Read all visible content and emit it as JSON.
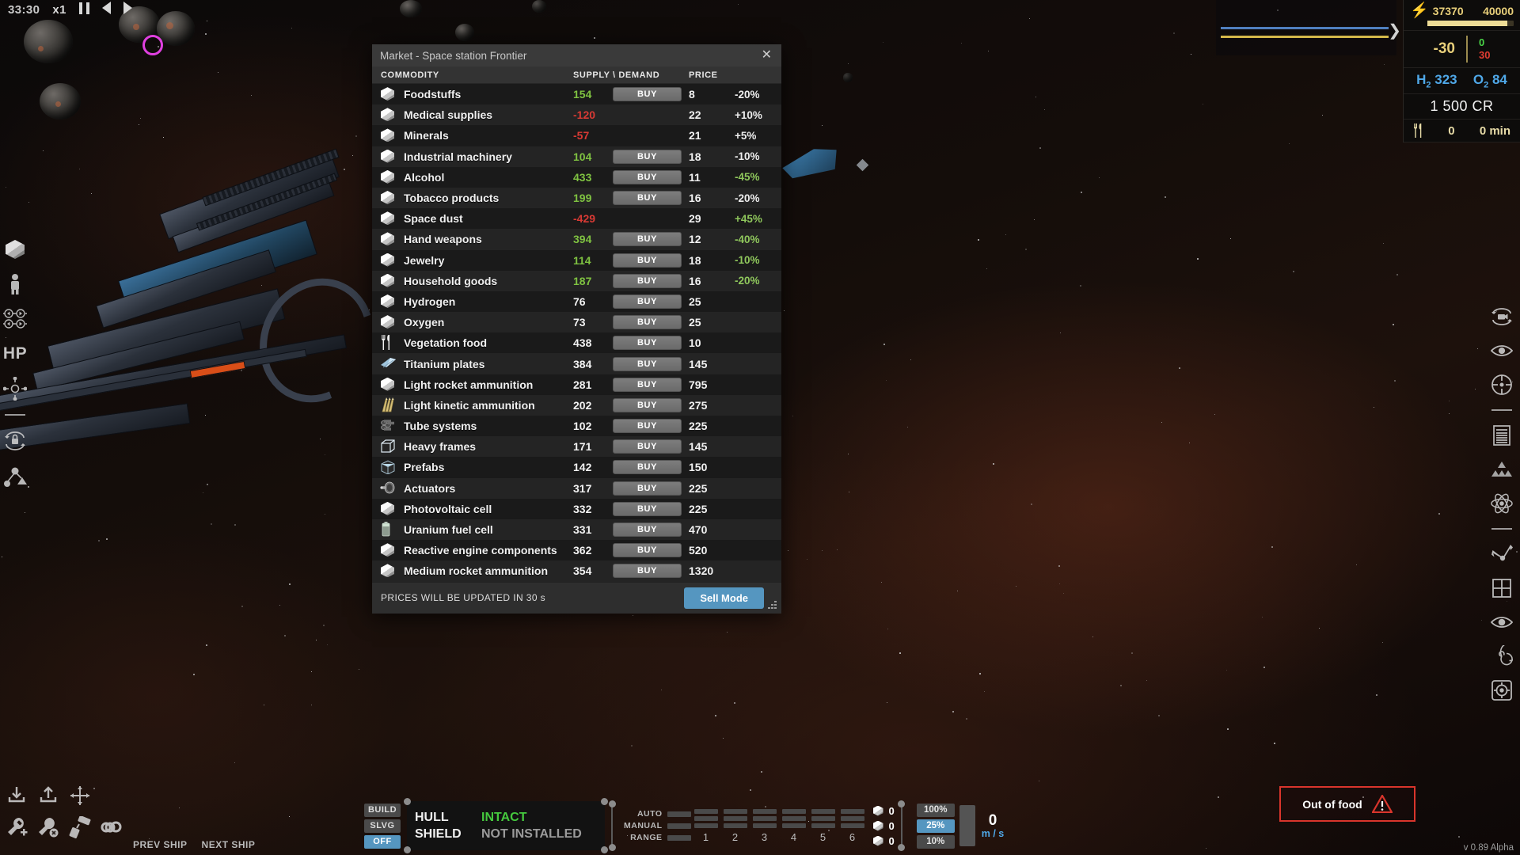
{
  "time_controls": {
    "clock": "33:30",
    "speed": "x1",
    "pause_icon": "pause-icon",
    "prev_icon": "step-back-icon",
    "next_icon": "step-forward-icon"
  },
  "left_toolbar": [
    {
      "name": "cargo-cube-icon",
      "label": ""
    },
    {
      "name": "crew-person-icon",
      "label": ""
    },
    {
      "name": "directional-arrows-icon",
      "label": ""
    },
    {
      "name": "hp-label",
      "label": "HP"
    },
    {
      "name": "crosshair-icon",
      "label": ""
    },
    {
      "name": "lock-rotate-icon",
      "label": ""
    },
    {
      "name": "node-graph-icon",
      "label": ""
    }
  ],
  "build_icons": [
    {
      "name": "download-icon"
    },
    {
      "name": "upload-icon"
    },
    {
      "name": "move-icon"
    },
    {
      "name": "wrench-add-icon"
    },
    {
      "name": "wrench-remove-icon"
    },
    {
      "name": "paint-roller-icon"
    },
    {
      "name": "infinity-icon"
    }
  ],
  "right_toolbar": [
    {
      "name": "camera-rotate-icon"
    },
    {
      "name": "eye-icon"
    },
    {
      "name": "target-reticle-icon"
    },
    {
      "name": "document-list-icon"
    },
    {
      "name": "pyramid-stack-icon"
    },
    {
      "name": "atom-icon"
    },
    {
      "name": "trajectory-icon"
    },
    {
      "name": "grid-icon"
    },
    {
      "name": "eye-visibility-icon"
    },
    {
      "name": "galaxy-spiral-icon"
    },
    {
      "name": "target-lock-icon"
    }
  ],
  "hud": {
    "energy_icon": "lightning-bolt-icon",
    "energy_current": "37370",
    "energy_max": "40000",
    "energy_percent": 93,
    "power_balance": "-30",
    "power_in": "0",
    "power_out": "30",
    "hydrogen_label": "H",
    "hydrogen_sub": "2",
    "hydrogen_value": "323",
    "oxygen_label": "O",
    "oxygen_sub": "2",
    "oxygen_value": "84",
    "credits": "1 500 CR",
    "food_icon": "cutlery-icon",
    "food_amount": "0",
    "food_time": "0 min",
    "expand_icon": "chevron-right-icon"
  },
  "market": {
    "title": "Market - Space station Frontier",
    "close_icon": "close-icon",
    "columns": {
      "commodity": "COMMODITY",
      "supply": "SUPPLY \\ DEMAND",
      "price": "PRICE"
    },
    "buy_label": "BUY",
    "footer_timer": "PRICES WILL BE UPDATED IN 30 s",
    "sell_mode_label": "Sell Mode",
    "accent_color": "#5596c0",
    "resize_grip_icon": "resize-grip-icon",
    "rows": [
      {
        "icon": "cube-icon",
        "name": "Foodstuffs",
        "supply": "154",
        "supply_state": "pos",
        "buy": true,
        "price": "8",
        "pct": "-20%",
        "pct_hl": false
      },
      {
        "icon": "cube-icon",
        "name": "Medical supplies",
        "supply": "-120",
        "supply_state": "neg",
        "buy": false,
        "price": "22",
        "pct": "+10%",
        "pct_hl": false
      },
      {
        "icon": "cube-icon",
        "name": "Minerals",
        "supply": "-57",
        "supply_state": "neg",
        "buy": false,
        "price": "21",
        "pct": "+5%",
        "pct_hl": false
      },
      {
        "icon": "cube-icon",
        "name": "Industrial machinery",
        "supply": "104",
        "supply_state": "pos",
        "buy": true,
        "price": "18",
        "pct": "-10%",
        "pct_hl": false
      },
      {
        "icon": "cube-icon",
        "name": "Alcohol",
        "supply": "433",
        "supply_state": "pos",
        "buy": true,
        "price": "11",
        "pct": "-45%",
        "pct_hl": true
      },
      {
        "icon": "cube-icon",
        "name": "Tobacco products",
        "supply": "199",
        "supply_state": "pos",
        "buy": true,
        "price": "16",
        "pct": "-20%",
        "pct_hl": false
      },
      {
        "icon": "cube-icon",
        "name": "Space dust",
        "supply": "-429",
        "supply_state": "neg",
        "buy": false,
        "price": "29",
        "pct": "+45%",
        "pct_hl": true
      },
      {
        "icon": "cube-icon",
        "name": "Hand weapons",
        "supply": "394",
        "supply_state": "pos",
        "buy": true,
        "price": "12",
        "pct": "-40%",
        "pct_hl": true
      },
      {
        "icon": "cube-icon",
        "name": "Jewelry",
        "supply": "114",
        "supply_state": "pos",
        "buy": true,
        "price": "18",
        "pct": "-10%",
        "pct_hl": true
      },
      {
        "icon": "cube-icon",
        "name": "Household goods",
        "supply": "187",
        "supply_state": "pos",
        "buy": true,
        "price": "16",
        "pct": "-20%",
        "pct_hl": true
      },
      {
        "icon": "cube-icon",
        "name": "Hydrogen",
        "supply": "76",
        "supply_state": "neu",
        "buy": true,
        "price": "25",
        "pct": "",
        "pct_hl": false
      },
      {
        "icon": "cube-icon",
        "name": "Oxygen",
        "supply": "73",
        "supply_state": "neu",
        "buy": true,
        "price": "25",
        "pct": "",
        "pct_hl": false
      },
      {
        "icon": "cutlery-icon",
        "name": "Vegetation food",
        "supply": "438",
        "supply_state": "neu",
        "buy": true,
        "price": "10",
        "pct": "",
        "pct_hl": false
      },
      {
        "icon": "plate-icon",
        "name": "Titanium plates",
        "supply": "384",
        "supply_state": "neu",
        "buy": true,
        "price": "145",
        "pct": "",
        "pct_hl": false
      },
      {
        "icon": "cube-icon",
        "name": "Light rocket ammunition",
        "supply": "281",
        "supply_state": "neu",
        "buy": true,
        "price": "795",
        "pct": "",
        "pct_hl": false
      },
      {
        "icon": "bullets-icon",
        "name": "Light kinetic ammunition",
        "supply": "202",
        "supply_state": "neu",
        "buy": true,
        "price": "275",
        "pct": "",
        "pct_hl": false
      },
      {
        "icon": "tubes-icon",
        "name": "Tube systems",
        "supply": "102",
        "supply_state": "neu",
        "buy": true,
        "price": "225",
        "pct": "",
        "pct_hl": false
      },
      {
        "icon": "frame-icon",
        "name": "Heavy frames",
        "supply": "171",
        "supply_state": "neu",
        "buy": true,
        "price": "145",
        "pct": "",
        "pct_hl": false
      },
      {
        "icon": "prefab-icon",
        "name": "Prefabs",
        "supply": "142",
        "supply_state": "neu",
        "buy": true,
        "price": "150",
        "pct": "",
        "pct_hl": false
      },
      {
        "icon": "actuator-icon",
        "name": "Actuators",
        "supply": "317",
        "supply_state": "neu",
        "buy": true,
        "price": "225",
        "pct": "",
        "pct_hl": false
      },
      {
        "icon": "cube-icon",
        "name": "Photovoltaic cell",
        "supply": "332",
        "supply_state": "neu",
        "buy": true,
        "price": "225",
        "pct": "",
        "pct_hl": false
      },
      {
        "icon": "fuelcell-icon",
        "name": "Uranium fuel cell",
        "supply": "331",
        "supply_state": "neu",
        "buy": true,
        "price": "470",
        "pct": "",
        "pct_hl": false
      },
      {
        "icon": "cube-icon",
        "name": "Reactive engine components",
        "supply": "362",
        "supply_state": "neu",
        "buy": true,
        "price": "520",
        "pct": "",
        "pct_hl": false
      },
      {
        "icon": "cube-icon",
        "name": "Medium rocket ammunition",
        "supply": "354",
        "supply_state": "neu",
        "buy": true,
        "price": "1320",
        "pct": "",
        "pct_hl": false
      }
    ]
  },
  "bottom_bar": {
    "modes": [
      {
        "label": "BUILD",
        "active": false
      },
      {
        "label": "SLVG",
        "active": false
      },
      {
        "label": "OFF",
        "active": true
      }
    ],
    "hull_label": "HULL",
    "hull_status": "INTACT",
    "shield_label": "SHIELD",
    "shield_status": "NOT INSTALLED",
    "fire_modes": [
      {
        "label": "AUTO"
      },
      {
        "label": "MANUAL"
      },
      {
        "label": "RANGE"
      }
    ],
    "weapon_groups": [
      "1",
      "2",
      "3",
      "4",
      "5",
      "6"
    ],
    "ammo_counts": [
      "0",
      "0",
      "0"
    ],
    "throttle_presets": [
      {
        "label": "100%",
        "active": false
      },
      {
        "label": "25%",
        "active": true
      },
      {
        "label": "10%",
        "active": false
      }
    ],
    "speed_value": "0",
    "speed_unit": "m / s",
    "prev_ship": "PREV SHIP",
    "next_ship": "NEXT SHIP"
  },
  "warning": {
    "text": "Out of food",
    "icon": "warning-triangle-icon",
    "border_color": "#d9352c"
  },
  "version": "v 0.89 Alpha"
}
